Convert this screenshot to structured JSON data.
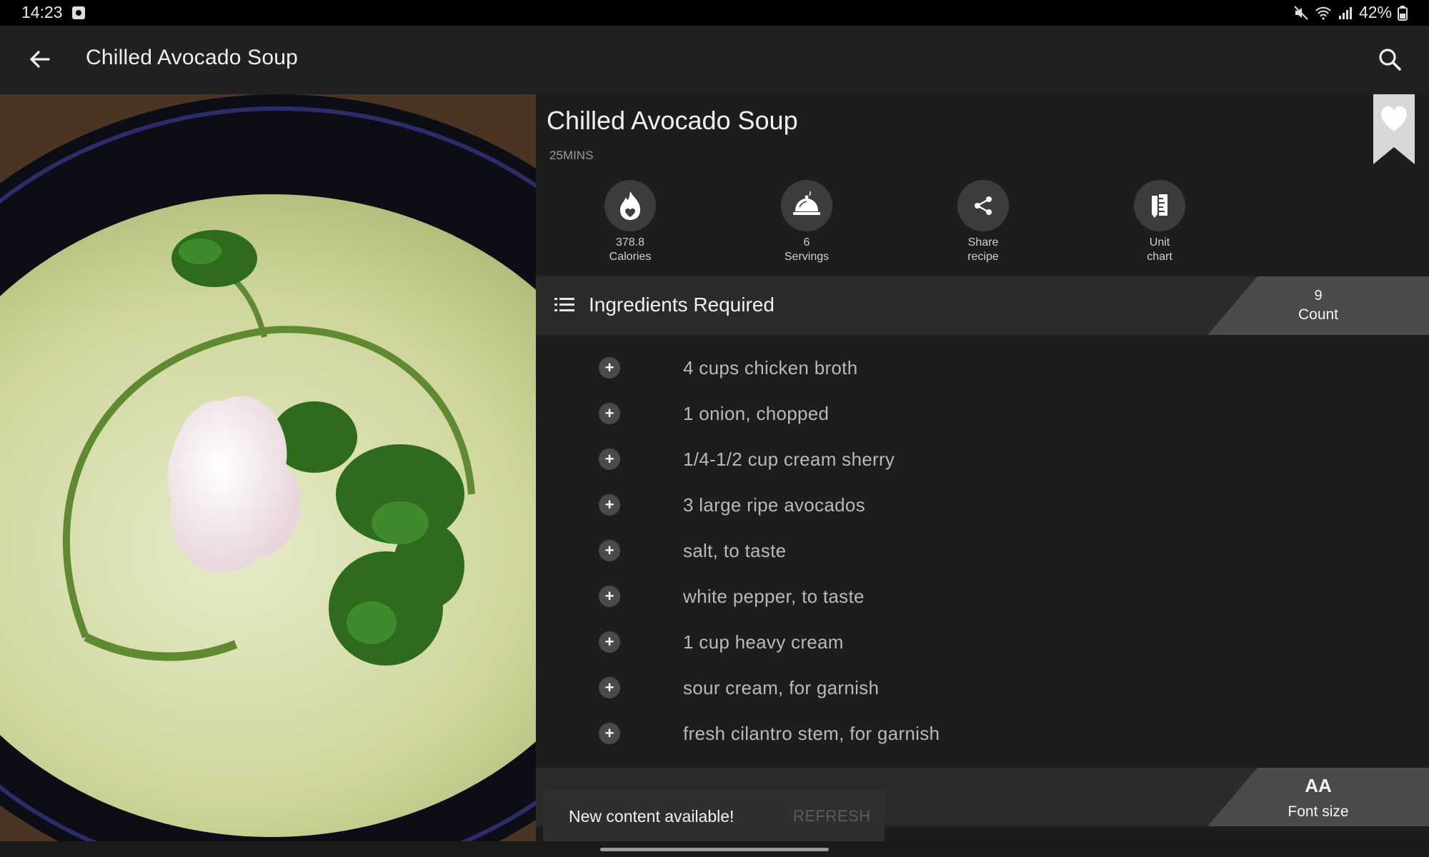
{
  "status_bar": {
    "time": "14:23",
    "battery": "42%"
  },
  "app_bar": {
    "title": "Chilled Avocado Soup"
  },
  "recipe": {
    "title": "Chilled Avocado Soup",
    "time": "25MINS",
    "stats": [
      {
        "value": "378.8",
        "label": "Calories",
        "icon": "flame-icon"
      },
      {
        "value": "6",
        "label": "Servings",
        "icon": "cloche-icon"
      },
      {
        "value": "Share",
        "label": "recipe",
        "icon": "share-icon"
      },
      {
        "value": "Unit",
        "label": "chart",
        "icon": "ruler-icon"
      }
    ]
  },
  "ingredients": {
    "header": "Ingredients Required",
    "count": "9",
    "count_label": "Count",
    "items": [
      "4 cups chicken broth",
      "1 onion, chopped",
      "1/4-1/2 cup cream sherry",
      "3 large ripe avocados",
      "salt, to taste",
      "white pepper, to taste",
      "1 cup heavy cream",
      "sour cream, for garnish",
      "fresh cilantro stem, for garnish"
    ]
  },
  "font_size": {
    "label": "Font size",
    "glyph": "AA"
  },
  "snackbar": {
    "message": "New content available!",
    "action": "REFRESH"
  },
  "colors": {
    "background": "#1c1c1e",
    "app_bar": "#212123",
    "header_bar": "#2b2b2e",
    "tab": "#4a4a4d",
    "text_primary": "#f0f0f0",
    "text_secondary": "#b9b9b9"
  }
}
